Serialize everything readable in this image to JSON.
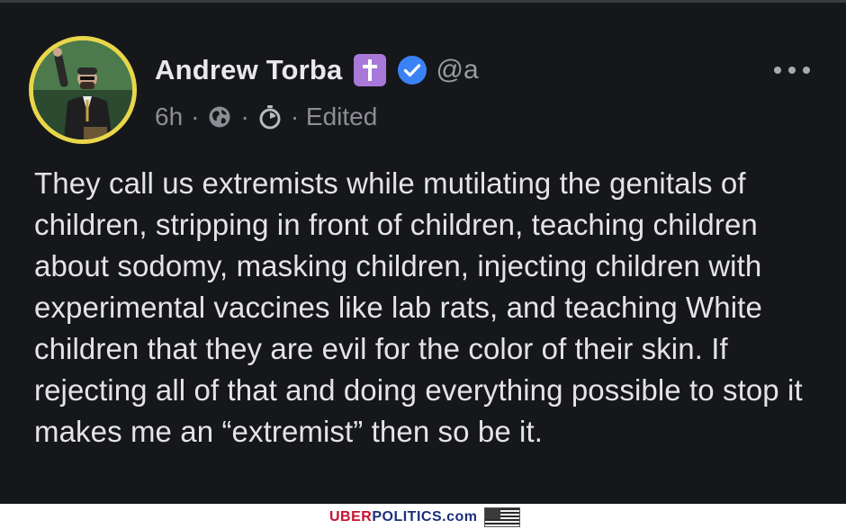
{
  "post": {
    "author_name": "Andrew Torba",
    "handle": "@a",
    "time": "6h",
    "separator": "·",
    "edited_label": "· Edited",
    "body": "They call us extremists while mutilating the genitals of children, stripping in front of children, teaching children about sodomy, masking children, injecting children with experimental vaccines like lab rats, and teaching White children that they are evil for the color of their skin. If rejecting all of that and doing everything possible to stop it makes me an “extremist” then so be it.",
    "icons": {
      "cross_badge": "cross-icon",
      "verified_badge": "verified-check-icon",
      "visibility": "globe-icon",
      "timer": "stopwatch-icon",
      "more": "more-horizontal-icon"
    }
  },
  "watermark": {
    "text_red": "UBER",
    "text_blue": "POLITICS.com"
  },
  "colors": {
    "background": "#16171b",
    "avatar_ring": "#e9d64a",
    "cross_badge": "#a879d8",
    "verified": "#3b82f6",
    "text_primary": "#e4e4e7",
    "text_muted": "#8d8e94"
  }
}
